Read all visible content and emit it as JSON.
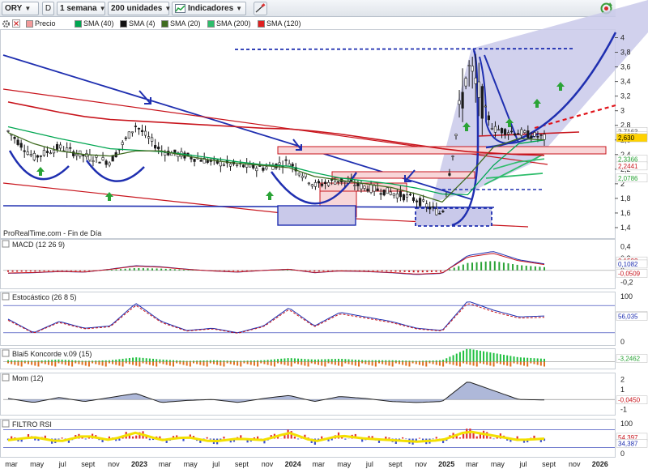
{
  "toolbar": {
    "symbol": "ORY",
    "d_button": "D",
    "timeframe": "1 semana",
    "units": "200 unidades",
    "indicators": "Indicadores"
  },
  "legend": [
    {
      "label": "Precio",
      "color": "#f29a9a"
    },
    {
      "label": "SMA (40)",
      "color": "#00a651"
    },
    {
      "label": "SMA (4)",
      "color": "#111111"
    },
    {
      "label": "SMA (20)",
      "color": "#3f6b1f"
    },
    {
      "label": "SMA (200)",
      "color": "#2ebd6b"
    },
    {
      "label": "SMA (120)",
      "color": "#e02020"
    }
  ],
  "source_label": "ProRealTime.com - Fin de Día",
  "colors": {
    "candle_up": "#1a1a1a",
    "trend_blue": "#1f2fb0",
    "trend_red": "#c8151d",
    "fill_lavender": "#c9c9ea",
    "support_box": "#f8d6d8",
    "green_arrow": "#2aa336"
  },
  "chart_data": [
    {
      "type": "line",
      "panel": "price",
      "y_axis_ticks": [
        "1,4",
        "1,6",
        "1,8",
        "2",
        "2,2",
        "2,4",
        "2,6",
        "2,8",
        "3",
        "3,2",
        "3,4",
        "3,6",
        "3,8",
        "4"
      ],
      "ylim": [
        1.3,
        4.05
      ],
      "x": [
        "2022-03",
        "2022-05",
        "2022-07",
        "2022-09",
        "2022-11",
        "2023-01",
        "2023-03",
        "2023-05",
        "2023-07",
        "2023-09",
        "2023-11",
        "2024-01",
        "2024-03",
        "2024-05",
        "2024-07",
        "2024-09",
        "2024-11",
        "2025-01",
        "2025-03",
        "2025-05",
        "2025-07",
        "2025-08"
      ],
      "series": [
        {
          "key": "price",
          "values": [
            2.72,
            2.36,
            2.5,
            2.38,
            2.3,
            2.8,
            2.45,
            2.38,
            2.3,
            2.25,
            2.22,
            2.3,
            1.98,
            2.05,
            1.95,
            1.88,
            1.78,
            1.58,
            3.6,
            2.75,
            2.7,
            2.63
          ]
        },
        {
          "key": "sma40",
          "values": [
            2.78,
            2.7,
            2.62,
            2.55,
            2.48,
            2.46,
            2.44,
            2.4,
            2.35,
            2.3,
            2.26,
            2.24,
            2.15,
            2.08,
            2.04,
            2.0,
            1.94,
            1.86,
            1.85,
            2.25,
            2.55,
            2.6
          ]
        },
        {
          "key": "sma20",
          "values": [
            2.7,
            2.55,
            2.45,
            2.4,
            2.38,
            2.45,
            2.45,
            2.38,
            2.32,
            2.28,
            2.25,
            2.22,
            2.1,
            2.05,
            2.0,
            1.95,
            1.86,
            1.75,
            2.1,
            2.5,
            2.62,
            2.6
          ]
        },
        {
          "key": "sma120",
          "values": [
            3.12,
            3.05,
            2.98,
            2.92,
            2.88,
            2.86,
            2.84,
            2.82,
            2.8,
            2.78,
            2.76,
            2.75,
            2.72,
            2.68,
            2.63,
            2.58,
            2.53,
            2.48,
            2.44,
            2.42,
            2.4,
            2.39
          ]
        },
        {
          "key": "sma200",
          "values": [
            null,
            null,
            null,
            null,
            null,
            null,
            null,
            null,
            null,
            null,
            null,
            null,
            null,
            null,
            null,
            null,
            null,
            null,
            null,
            2.2,
            2.3,
            2.34
          ]
        }
      ],
      "price_badges": [
        {
          "label": "2,7163",
          "value": 2.7163,
          "bg": "#ffffff",
          "fg": "#444444"
        },
        {
          "label": "2,6575",
          "value": 2.6575,
          "bg": "#ffffff",
          "fg": "#444444"
        },
        {
          "label": "2,630",
          "value": 2.63,
          "bg": "#ffd200",
          "fg": "#000000"
        },
        {
          "label": "2,3366",
          "value": 2.3366,
          "bg": "#ffffff",
          "fg": "#2aa336"
        },
        {
          "label": "2,2441",
          "value": 2.2441,
          "bg": "#ffffff",
          "fg": "#c8151d"
        },
        {
          "label": "2,0786",
          "value": 2.0786,
          "bg": "#ffffff",
          "fg": "#2aa336"
        }
      ],
      "x_tick_labels": [
        "mar",
        "may",
        "jul",
        "sept",
        "nov",
        "2023",
        "mar",
        "may",
        "jul",
        "sept",
        "nov",
        "2024",
        "mar",
        "may",
        "jul",
        "sept",
        "nov",
        "2025",
        "mar",
        "may",
        "jul",
        "sept",
        "nov",
        "2026"
      ]
    },
    {
      "type": "line",
      "panel": "macd",
      "title": "MACD (12 26 9)",
      "y_axis_ticks": [
        "0,4",
        "0,2",
        "0",
        "-0,2"
      ],
      "ylim": [
        -0.25,
        0.45
      ],
      "badges": [
        {
          "label": "0,1592",
          "value": 0.1592,
          "fg": "#c8151d"
        },
        {
          "label": "0,1082",
          "value": 0.1082,
          "fg": "#1f2fb0"
        },
        {
          "label": "-0,0509",
          "value": -0.0509,
          "fg": "#c8151d"
        }
      ],
      "values": [
        -0.05,
        -0.04,
        -0.02,
        -0.03,
        0.02,
        0.08,
        0.06,
        0.02,
        -0.01,
        -0.03,
        0.0,
        0.02,
        -0.04,
        -0.01,
        -0.02,
        -0.04,
        -0.07,
        -0.05,
        0.25,
        0.32,
        0.18,
        0.11
      ]
    },
    {
      "type": "line",
      "panel": "estocastico",
      "title": "Estocástico (26 8 5)",
      "y_axis_ticks": [
        "100",
        "0"
      ],
      "ylim": [
        0,
        100
      ],
      "badges": [
        {
          "label": "58,230",
          "value": 58.23,
          "fg": "#c8151d"
        },
        {
          "label": "56,035",
          "value": 56.035,
          "fg": "#1f2fb0"
        }
      ],
      "values": [
        50,
        20,
        45,
        30,
        35,
        85,
        45,
        25,
        30,
        20,
        35,
        75,
        35,
        65,
        55,
        45,
        30,
        25,
        90,
        70,
        55,
        57
      ]
    },
    {
      "type": "area",
      "panel": "koncorde",
      "title": "Blai5 Koncorde v.09 (15)",
      "y_axis_ticks": [
        "0"
      ],
      "badges": [
        {
          "label": "-3,2462",
          "value": -3.2462,
          "fg": "#2aa336"
        }
      ],
      "values": [
        2,
        1,
        3,
        1,
        2,
        6,
        3,
        1,
        2,
        1,
        2,
        5,
        3,
        4,
        2,
        2,
        1,
        2,
        18,
        12,
        6,
        4
      ]
    },
    {
      "type": "area",
      "panel": "mom",
      "title": "Mom (12)",
      "y_axis_ticks": [
        "2",
        "1",
        "0",
        "-1"
      ],
      "ylim": [
        -1.2,
        2.2
      ],
      "badges": [
        {
          "label": "-0,0450",
          "value": -0.045,
          "fg": "#c8151d"
        }
      ],
      "values": [
        0.1,
        -0.3,
        0.2,
        -0.2,
        0.2,
        0.6,
        -0.3,
        -0.1,
        0.0,
        -0.3,
        0.1,
        0.4,
        -0.2,
        0.3,
        0.1,
        -0.2,
        -0.3,
        -0.2,
        1.8,
        0.9,
        0.0,
        -0.05
      ]
    },
    {
      "type": "line",
      "panel": "rsi",
      "title": "FILTRO RSI",
      "y_axis_ticks": [
        "100",
        "0"
      ],
      "ylim": [
        0,
        100
      ],
      "badges": [
        {
          "label": "54,397",
          "value": 54.397,
          "fg": "#c8151d"
        },
        {
          "label": "34,387",
          "value": 34.387,
          "fg": "#1f2fb0"
        }
      ],
      "values": [
        45,
        55,
        40,
        60,
        45,
        70,
        45,
        55,
        40,
        50,
        45,
        70,
        40,
        60,
        50,
        45,
        40,
        45,
        75,
        60,
        45,
        50
      ]
    }
  ]
}
